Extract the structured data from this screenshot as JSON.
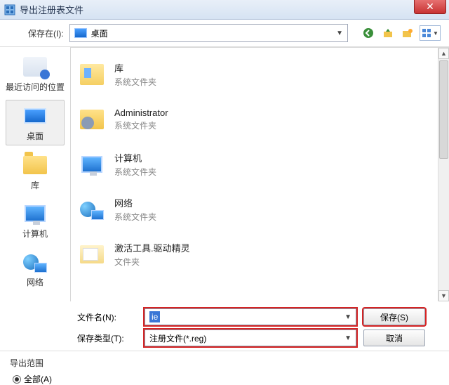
{
  "window": {
    "title": "导出注册表文件",
    "close_glyph": "✕"
  },
  "toolbar": {
    "save_in_label": "保存在(I):",
    "save_in_value": "桌面",
    "icons": {
      "back": "back-icon",
      "up": "up-one-level-icon",
      "newfolder": "new-folder-icon",
      "viewmenu": "view-menu-icon"
    }
  },
  "places": [
    {
      "key": "recent",
      "label": "最近访问的位置",
      "selected": false
    },
    {
      "key": "desktop",
      "label": "桌面",
      "selected": true
    },
    {
      "key": "libraries",
      "label": "库",
      "selected": false
    },
    {
      "key": "computer",
      "label": "计算机",
      "selected": false
    },
    {
      "key": "network",
      "label": "网络",
      "selected": false
    }
  ],
  "listing": [
    {
      "name": "库",
      "sub": "系统文件夹",
      "icon": "libraries"
    },
    {
      "name": "Administrator",
      "sub": "系统文件夹",
      "icon": "user"
    },
    {
      "name": "计算机",
      "sub": "系统文件夹",
      "icon": "computer"
    },
    {
      "name": "网络",
      "sub": "系统文件夹",
      "icon": "network"
    },
    {
      "name": "激活工具.驱动精灵",
      "sub": "文件夹",
      "icon": "folder"
    }
  ],
  "form": {
    "filename_label": "文件名(N):",
    "filename_value": "ie",
    "filetype_label": "保存类型(T):",
    "filetype_value": "注册文件(*.reg)",
    "save_btn": "保存(S)",
    "cancel_btn": "取消"
  },
  "export_range": {
    "legend": "导出范围",
    "all_label": "全部(A)",
    "all_checked": true
  }
}
